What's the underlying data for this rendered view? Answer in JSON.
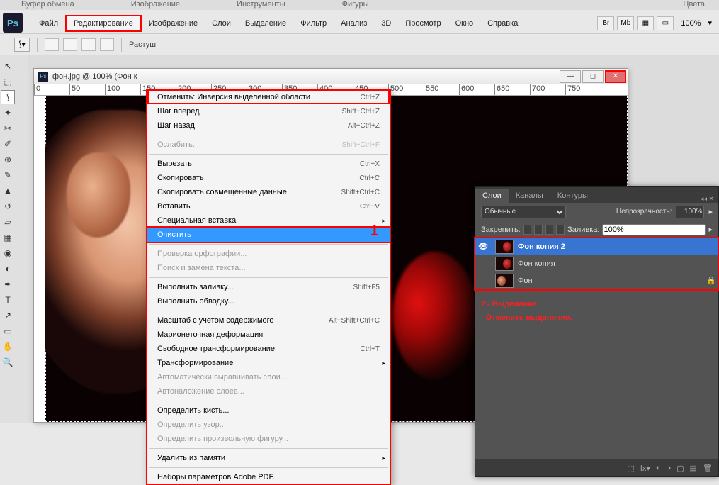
{
  "top_labels": [
    "Буфер обмена",
    "Изображение",
    "Инструменты",
    "Фигуры",
    "Цвета"
  ],
  "menubar": {
    "items": [
      "Файл",
      "Редактирование",
      "Изображение",
      "Слои",
      "Выделение",
      "Фильтр",
      "Анализ",
      "3D",
      "Просмотр",
      "Окно",
      "Справка"
    ],
    "active_index": 1,
    "right_icons": [
      "Br",
      "Mb",
      "▦"
    ],
    "zoom": "100%"
  },
  "optbar": {
    "label": "Растуш"
  },
  "doc": {
    "title": "фон.jpg @ 100% (Фон к",
    "ruler_marks": [
      "0",
      "50",
      "100",
      "150",
      "200",
      "250",
      "300",
      "350",
      "400",
      "450",
      "500",
      "550",
      "600",
      "650",
      "700",
      "750"
    ]
  },
  "dropdown": {
    "marker": "1",
    "items": [
      {
        "t": "Отменить: Инверсия выделенной области",
        "sc": "Ctrl+Z",
        "hl": "undo"
      },
      {
        "t": "Шаг вперед",
        "sc": "Shift+Ctrl+Z"
      },
      {
        "t": "Шаг назад",
        "sc": "Alt+Ctrl+Z"
      },
      {
        "sep": true
      },
      {
        "t": "Ослабить...",
        "sc": "Shift+Ctrl+F",
        "dis": true
      },
      {
        "sep": true
      },
      {
        "t": "Вырезать",
        "sc": "Ctrl+X"
      },
      {
        "t": "Скопировать",
        "sc": "Ctrl+C"
      },
      {
        "t": "Скопировать совмещенные данные",
        "sc": "Shift+Ctrl+C"
      },
      {
        "t": "Вставить",
        "sc": "Ctrl+V"
      },
      {
        "t": "Специальная вставка",
        "sub": true
      },
      {
        "t": "Очистить",
        "sel": true,
        "hl": "clear"
      },
      {
        "sep": true
      },
      {
        "t": "Проверка орфографии...",
        "dis": true
      },
      {
        "t": "Поиск и замена текста...",
        "dis": true
      },
      {
        "sep": true
      },
      {
        "t": "Выполнить заливку...",
        "sc": "Shift+F5"
      },
      {
        "t": "Выполнить обводку..."
      },
      {
        "sep": true
      },
      {
        "t": "Масштаб с учетом содержимого",
        "sc": "Alt+Shift+Ctrl+C"
      },
      {
        "t": "Марионеточная деформация"
      },
      {
        "t": "Свободное трансформирование",
        "sc": "Ctrl+T"
      },
      {
        "t": "Трансформирование",
        "sub": true
      },
      {
        "t": "Автоматически выравнивать слои...",
        "dis": true
      },
      {
        "t": "Автоналожение слоев...",
        "dis": true
      },
      {
        "sep": true
      },
      {
        "t": "Определить кисть..."
      },
      {
        "t": "Определить узор...",
        "dis": true
      },
      {
        "t": "Определить произвольную фигуру...",
        "dis": true
      },
      {
        "sep": true
      },
      {
        "t": "Удалить из памяти",
        "sub": true
      },
      {
        "sep": true
      },
      {
        "t": "Наборы параметров Adobe PDF..."
      }
    ]
  },
  "layers": {
    "tabs": [
      "Слои",
      "Каналы",
      "Контуры"
    ],
    "blend_mode": "Обычные",
    "opacity_label": "Непрозрачность:",
    "opacity": "100%",
    "lock_label": "Закрепить:",
    "fill_label": "Заливка:",
    "fill": "100%",
    "rows": [
      {
        "name": "Фон копия 2",
        "sel": true,
        "eye": true,
        "thumb": "red"
      },
      {
        "name": "Фон копия",
        "eye": false,
        "thumb": "red"
      },
      {
        "name": "Фон",
        "eye": false,
        "thumb": "ear",
        "lock": true
      }
    ],
    "annot1": "2 - Выделение",
    "annot2": " - Отменить выделение."
  },
  "tools": [
    "▱",
    "⬚",
    "◯",
    "✂",
    "✎",
    "▤",
    "✐",
    "⌖",
    "⟳",
    "◉",
    "▭",
    "⬤",
    "⬛",
    "⬜"
  ]
}
